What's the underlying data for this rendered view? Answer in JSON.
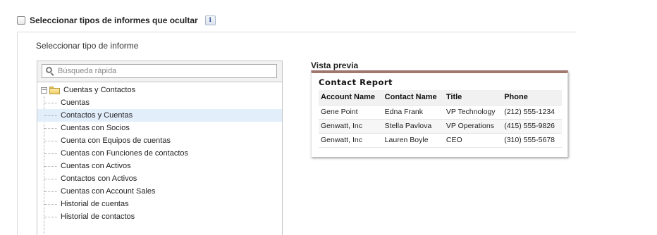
{
  "header": {
    "checkbox_label": "Seleccionar tipos de informes que ocultar",
    "checked": false,
    "info_glyph": "i"
  },
  "panel": {
    "title": "Seleccionar tipo de informe",
    "search": {
      "placeholder": "Búsqueda rápida",
      "icon": "search-icon"
    },
    "tree": {
      "root": {
        "label": "Cuentas y Contactos",
        "expanded": true,
        "toggle_glyph": "−",
        "icon": "folder-icon"
      },
      "items": [
        {
          "label": "Cuentas"
        },
        {
          "label": "Contactos y Cuentas",
          "selected": true
        },
        {
          "label": "Cuentas con Socios"
        },
        {
          "label": "Cuenta con Equipos de cuentas"
        },
        {
          "label": "Cuentas con Funciones de contactos"
        },
        {
          "label": "Cuentas con Activos"
        },
        {
          "label": "Contactos con Activos"
        },
        {
          "label": "Cuentas con Account Sales"
        },
        {
          "label": "Historial de cuentas"
        },
        {
          "label": "Historial de contactos"
        }
      ]
    }
  },
  "preview": {
    "heading": "Vista previa",
    "accent_color": "#a0776d",
    "report_title": "Contact Report",
    "columns": [
      "Account  Name",
      "Contact Name",
      "Title",
      "Phone"
    ],
    "rows": [
      [
        "Gene Point",
        "Edna Frank",
        "VP Technology",
        "(212) 555-1234"
      ],
      [
        "Genwatt, Inc",
        "Stella Pavlova",
        "VP Operations",
        "(415) 555-9826"
      ],
      [
        "Genwatt, Inc",
        "Lauren Boyle",
        "CEO",
        "(310) 555-5678"
      ]
    ]
  }
}
